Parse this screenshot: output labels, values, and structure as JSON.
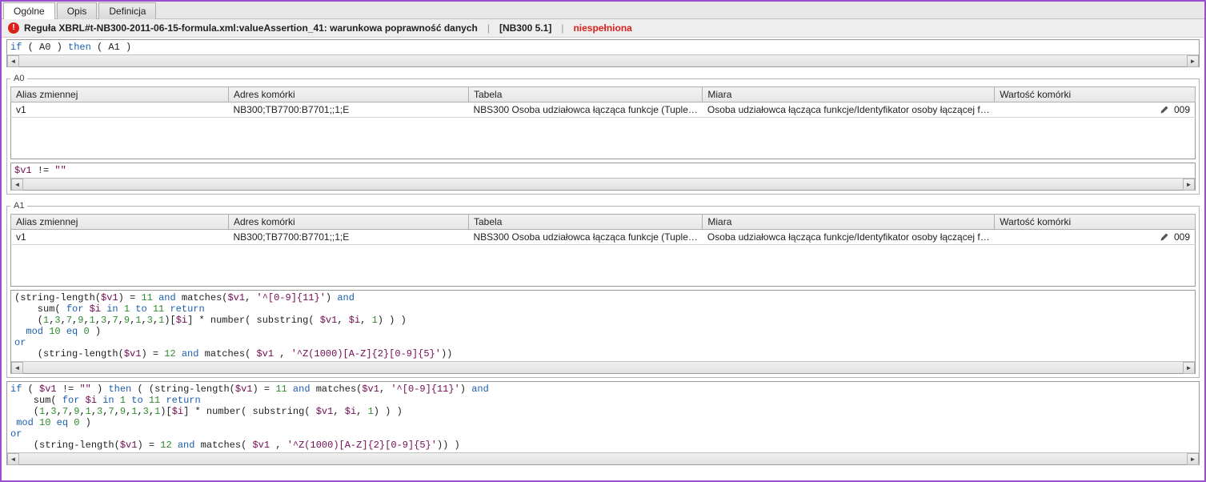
{
  "tabs": {
    "general": "Ogólne",
    "description": "Opis",
    "definition": "Definicja"
  },
  "rule": {
    "title": "Reguła XBRL#t-NB300-2011-06-15-formula.xml:valueAssertion_41: warunkowa poprawność danych",
    "ref": "[NB300 5.1]",
    "status": "niespełniona"
  },
  "code_top": "<span class=\"kw\">if</span> ( A0 ) <span class=\"kw\">then</span> ( A1 )",
  "blocks": {
    "a0": {
      "legend": "A0",
      "columns": {
        "alias": "Alias zmiennej",
        "addr": "Adres komórki",
        "table": "Tabela",
        "measure": "Miara",
        "value": "Wartość komórki"
      },
      "rows": [
        {
          "alias": "v1",
          "addr": "NB300;TB7700:B7701;;1;E",
          "table": "NBS300 Osoba udziałowca łącząca funkcje (Tuple…",
          "measure": "Osoba udziałowca łącząca funkcje/Identyfikator osoby łączącej f…",
          "value": "009"
        }
      ],
      "expr": "<span class=\"str\">$v1</span> != <span class=\"str\">\"\"</span>"
    },
    "a1": {
      "legend": "A1",
      "columns": {
        "alias": "Alias zmiennej",
        "addr": "Adres komórki",
        "table": "Tabela",
        "measure": "Miara",
        "value": "Wartość komórki"
      },
      "rows": [
        {
          "alias": "v1",
          "addr": "NB300;TB7700:B7701;;1;E",
          "table": "NBS300 Osoba udziałowca łącząca funkcje (Tuple…",
          "measure": "Osoba udziałowca łącząca funkcje/Identyfikator osoby łączącej f…",
          "value": "009"
        }
      ],
      "expr": "(string-length(<span class=\"str\">$v1</span>) = <span class=\"num\">11</span> <span class=\"kw\">and</span> matches(<span class=\"str\">$v1</span>, <span class=\"str\">'^[0-9]{11}'</span>) <span class=\"kw\">and</span>\n    sum( <span class=\"kw\">for</span> <span class=\"str\">$i</span> <span class=\"kw\">in</span> <span class=\"num\">1</span> <span class=\"kw\">to</span> <span class=\"num\">11</span> <span class=\"kw\">return</span>\n    (<span class=\"num\">1</span>,<span class=\"num\">3</span>,<span class=\"num\">7</span>,<span class=\"num\">9</span>,<span class=\"num\">1</span>,<span class=\"num\">3</span>,<span class=\"num\">7</span>,<span class=\"num\">9</span>,<span class=\"num\">1</span>,<span class=\"num\">3</span>,<span class=\"num\">1</span>)[<span class=\"str\">$i</span>] * number( substring( <span class=\"str\">$v1</span>, <span class=\"str\">$i</span>, <span class=\"num\">1</span>) ) )\n  <span class=\"kw\">mod</span> <span class=\"num\">10</span> <span class=\"kw\">eq</span> <span class=\"num\">0</span> )\n<span class=\"kw\">or</span>\n    (string-length(<span class=\"str\">$v1</span>) = <span class=\"num\">12</span> <span class=\"kw\">and</span> matches( <span class=\"str\">$v1</span> , <span class=\"str\">'^Z(1000)[A-Z]{2}[0-9]{5}'</span>))"
    }
  },
  "code_bottom": "<span class=\"kw\">if</span> ( <span class=\"str\">$v1</span> != <span class=\"str\">\"\"</span> ) <span class=\"kw\">then</span> ( (string-length(<span class=\"str\">$v1</span>) = <span class=\"num\">11</span> <span class=\"kw\">and</span> matches(<span class=\"str\">$v1</span>, <span class=\"str\">'^[0-9]{11}'</span>) <span class=\"kw\">and</span>\n    sum( <span class=\"kw\">for</span> <span class=\"str\">$i</span> <span class=\"kw\">in</span> <span class=\"num\">1</span> <span class=\"kw\">to</span> <span class=\"num\">11</span> <span class=\"kw\">return</span>\n    (<span class=\"num\">1</span>,<span class=\"num\">3</span>,<span class=\"num\">7</span>,<span class=\"num\">9</span>,<span class=\"num\">1</span>,<span class=\"num\">3</span>,<span class=\"num\">7</span>,<span class=\"num\">9</span>,<span class=\"num\">1</span>,<span class=\"num\">3</span>,<span class=\"num\">1</span>)[<span class=\"str\">$i</span>] * number( substring( <span class=\"str\">$v1</span>, <span class=\"str\">$i</span>, <span class=\"num\">1</span>) ) )\n <span class=\"kw\">mod</span> <span class=\"num\">10</span> <span class=\"kw\">eq</span> <span class=\"num\">0</span> )\n<span class=\"kw\">or</span>\n    (string-length(<span class=\"str\">$v1</span>) = <span class=\"num\">12</span> <span class=\"kw\">and</span> matches( <span class=\"str\">$v1</span> , <span class=\"str\">'^Z(1000)[A-Z]{2}[0-9]{5}'</span>)) )"
}
